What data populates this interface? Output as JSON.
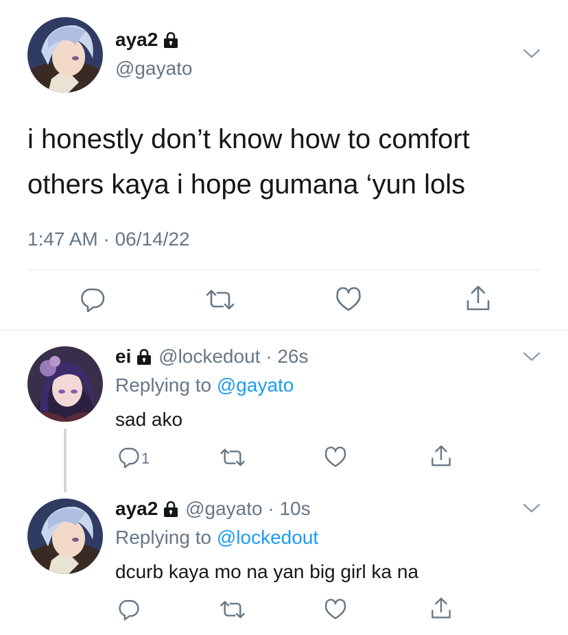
{
  "main_tweet": {
    "display_name": "aya2",
    "handle": "@gayato",
    "text_line1": "i honestly don’t know how to comfort",
    "text_line2": "others kaya i hope gumana ‘yun lols",
    "timestamp": "1:47 AM · 06/14/22"
  },
  "replies": [
    {
      "display_name": "ei",
      "handle": "@lockedout",
      "time": "· 26s",
      "replying_prefix": "Replying to",
      "replying_to": "@gayato",
      "text": "sad ako",
      "reply_count": "1"
    },
    {
      "display_name": "aya2",
      "handle": "@gayato",
      "time": "· 10s",
      "replying_prefix": "Replying to",
      "replying_to": "@lockedout",
      "text": "dcurb kaya mo na yan big girl ka na"
    }
  ],
  "icons": {
    "reply": "reply-icon",
    "retweet": "retweet-icon",
    "like": "heart-icon",
    "share": "share-icon",
    "lock": "lock-icon",
    "menu": "chevron-down-icon"
  },
  "colors": {
    "text": "#14171a",
    "secondary": "#657786",
    "link": "#1d9bf0",
    "divider": "#e1e8ed"
  }
}
